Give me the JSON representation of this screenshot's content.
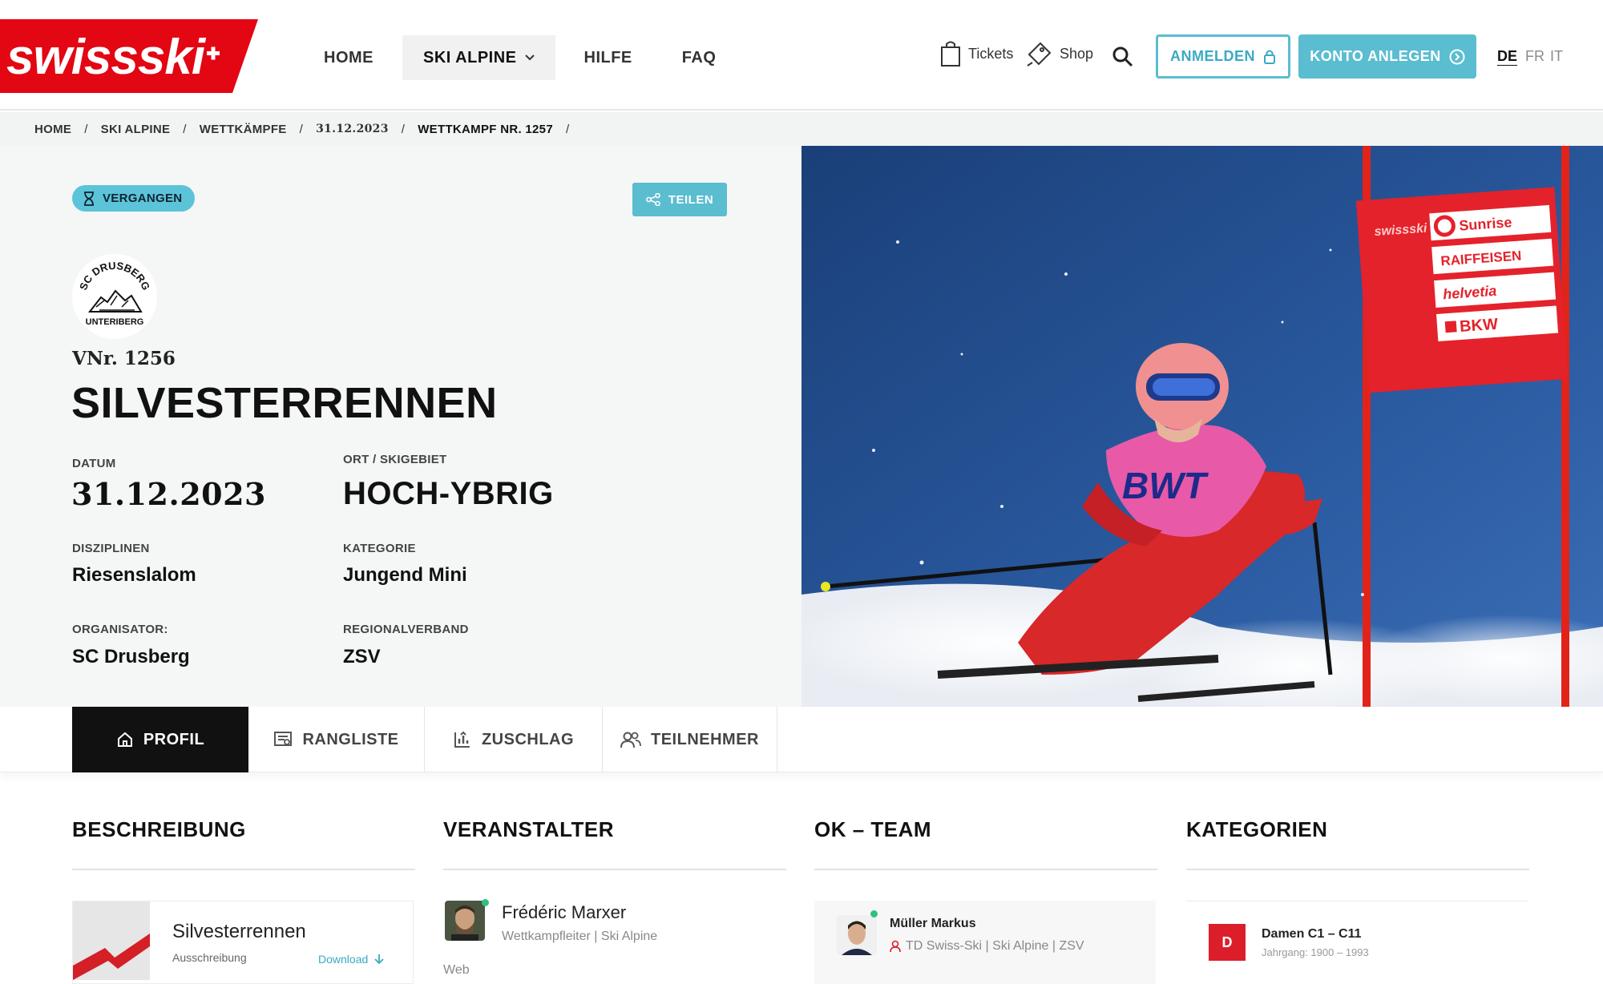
{
  "header": {
    "logo_text": "swissski",
    "nav": [
      {
        "label": "HOME"
      },
      {
        "label": "SKI ALPINE"
      },
      {
        "label": "HILFE"
      },
      {
        "label": "FAQ"
      }
    ],
    "tickets_label": "Tickets",
    "shop_label": "Shop",
    "login_label": "ANMELDEN",
    "register_label": "KONTO ANLEGEN",
    "languages": [
      "DE",
      "FR",
      "IT"
    ],
    "active_language": "DE",
    "brand_color": "#e30613",
    "accent_color": "#5bbdd0"
  },
  "breadcrumb": [
    "HOME",
    "SKI ALPINE",
    "WETTKÄMPFE",
    "31.12.2023",
    "WETTKAMPF NR. 1257"
  ],
  "event": {
    "status_badge": "VERGANGEN",
    "share_label": "TEILEN",
    "club_logo_text": [
      "SC DRUSBERG",
      "UNTERIBERG"
    ],
    "vnr": "VNr. 1256",
    "title": "SILVESTERRENNEN",
    "date_label": "DATUM",
    "date": "31.12.2023",
    "location_label": "ORT / SKIGEBIET",
    "location": "HOCH-YBRIG",
    "disciplines_label": "DISZIPLINEN",
    "disciplines": "Riesenslalom",
    "category_label": "KATEGORIE",
    "category": "Jungend Mini",
    "organizer_label": "ORGANISATOR:",
    "organizer": "SC Drusberg",
    "region_label": "REGIONALVERBAND",
    "region": "ZSV"
  },
  "hero_image": {
    "banner_texts": [
      "swissski",
      "Sunrise",
      "RAIFFEISEN",
      "helvetia",
      "BKW"
    ],
    "bib_text": "BWT"
  },
  "tabs": [
    {
      "label": "PROFIL"
    },
    {
      "label": "RANGLISTE"
    },
    {
      "label": "ZUSCHLAG"
    },
    {
      "label": "TEILNEHMER"
    }
  ],
  "sections": {
    "description": {
      "title": "BESCHREIBUNG",
      "doc_title": "Silvesterrennen",
      "doc_subtitle": "Ausschreibung",
      "download_label": "Download"
    },
    "organizer": {
      "title": "VERANSTALTER",
      "name": "Frédéric Marxer",
      "role": "Wettkampfleiter | Ski Alpine",
      "web_label": "Web"
    },
    "ok_team": {
      "title": "OK – TEAM",
      "name": "Müller Markus",
      "role": "TD Swiss-Ski | Ski Alpine | ZSV"
    },
    "categories": {
      "title": "KATEGORIEN",
      "badge": "D",
      "name": "Damen C1 – C11",
      "years": "Jahrgang: 1900 – 1993"
    }
  }
}
